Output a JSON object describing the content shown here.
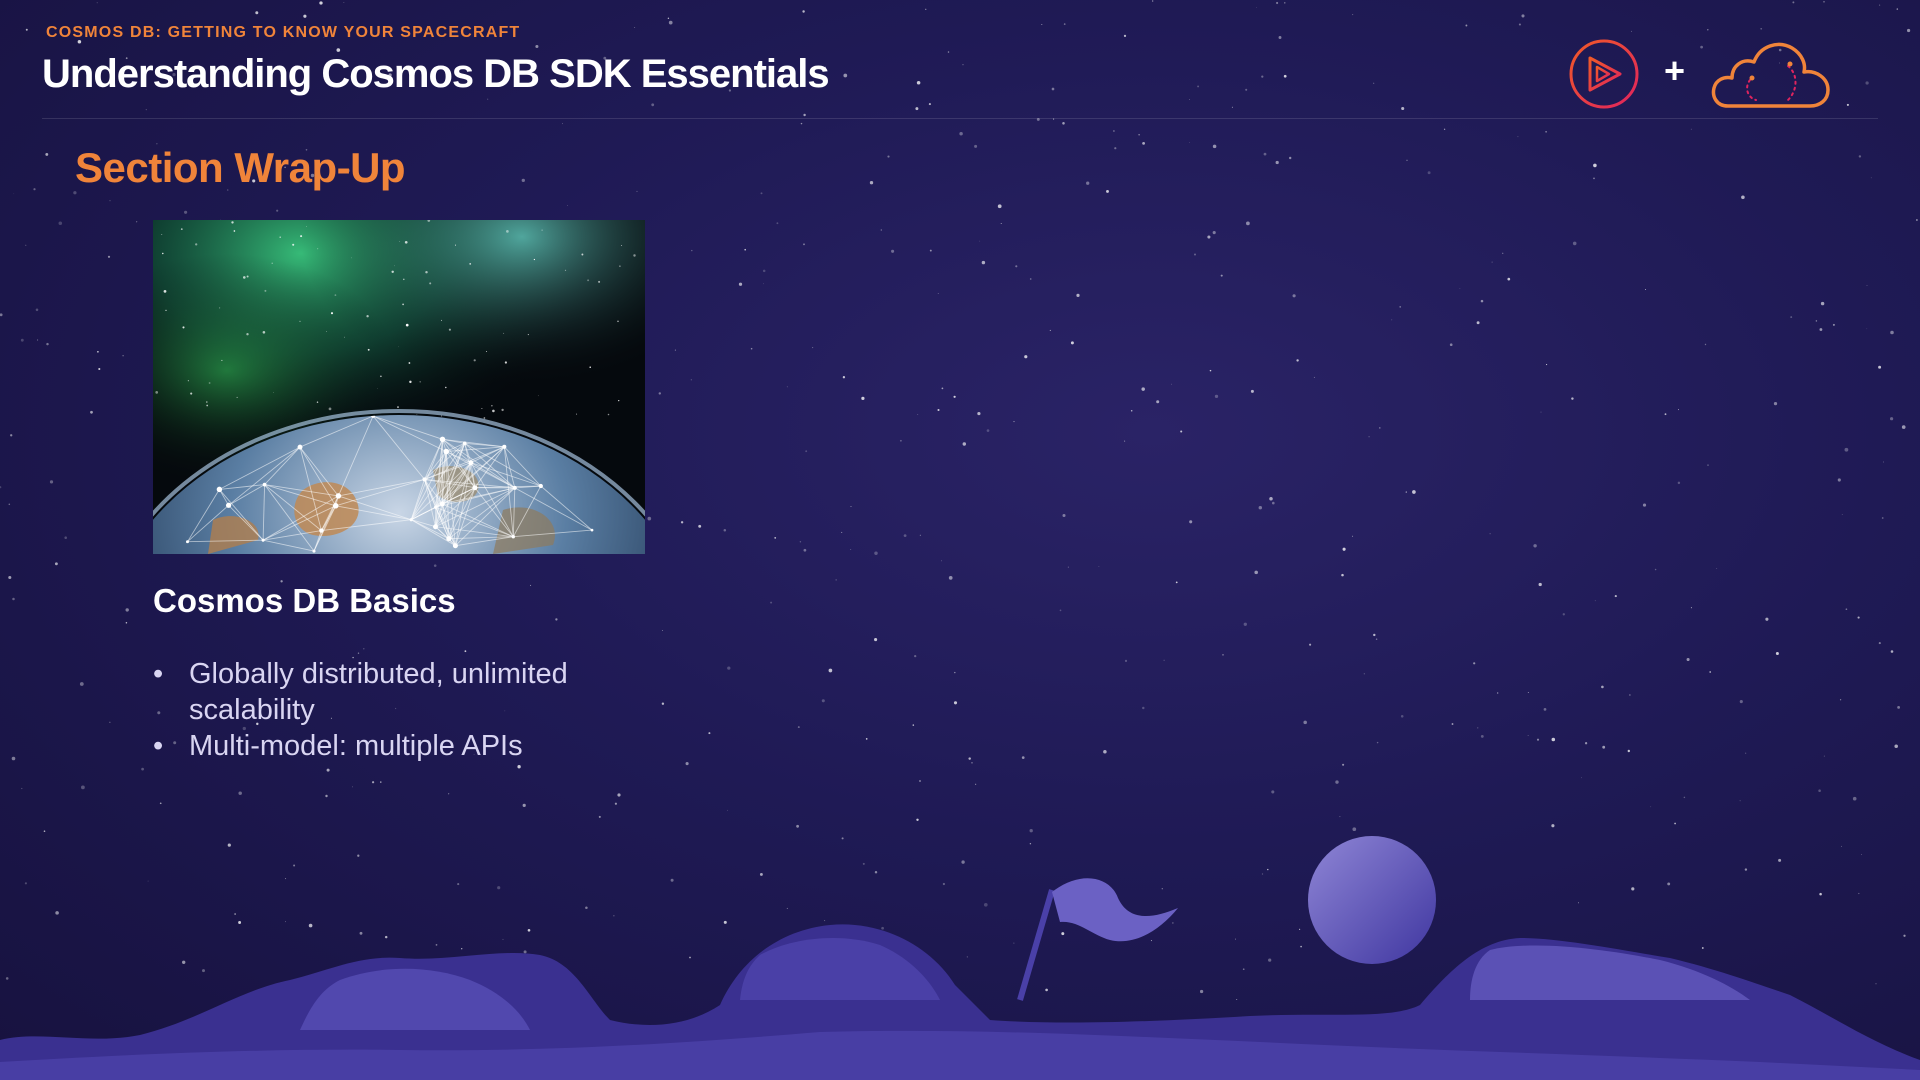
{
  "header": {
    "eyebrow": "COSMOS DB: GETTING TO KNOW YOUR SPACECRAFT",
    "title": "Understanding Cosmos DB SDK Essentials",
    "plus": "+"
  },
  "section": {
    "title": "Section Wrap-Up"
  },
  "card": {
    "title": "Cosmos DB Basics",
    "bullets": [
      "Globally distributed, unlimited scalability",
      "Multi-model: multiple APIs"
    ]
  },
  "icons": {
    "play_logo": "play-circle-icon",
    "cloud_logo": "cloud-icon"
  },
  "colors": {
    "accent_orange": "#f0843a",
    "logo_pink": "#e0245e",
    "background": "#1f1a55",
    "text_white": "#ffffff",
    "bullet_text": "#d9d5f2"
  }
}
